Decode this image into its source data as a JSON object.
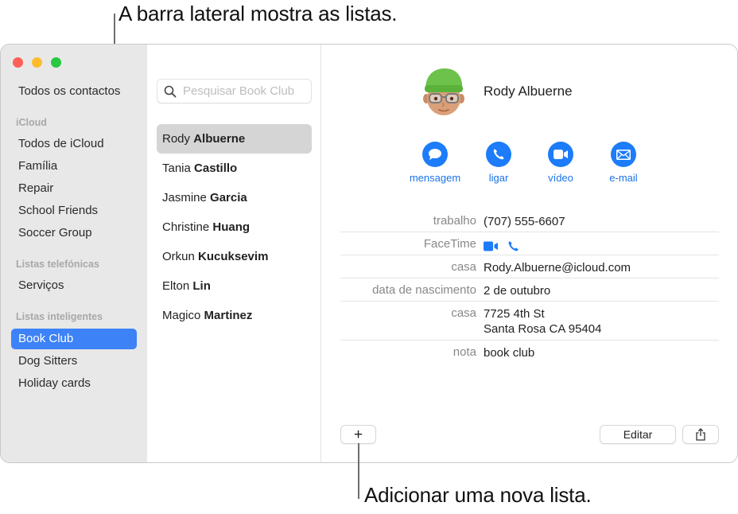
{
  "callouts": {
    "sidebar": "A barra lateral mostra as listas.",
    "add_list": "Adicionar uma nova lista."
  },
  "window": {
    "traffic_lights": [
      "close",
      "minimize",
      "zoom"
    ]
  },
  "sidebar": {
    "all_contacts": "Todos os contactos",
    "sections": [
      {
        "title": "iCloud",
        "items": [
          "Todos de iCloud",
          "Família",
          "Repair",
          "School Friends",
          "Soccer Group"
        ]
      },
      {
        "title": "Listas telefónicas",
        "items": [
          "Serviços"
        ]
      },
      {
        "title": "Listas inteligentes",
        "items": [
          "Book Club",
          "Dog Sitters",
          "Holiday cards"
        ]
      }
    ],
    "selected": "Book Club",
    "accent_color": "#3d82f7"
  },
  "list": {
    "search_placeholder": "Pesquisar Book Club",
    "search_value": "",
    "contacts": [
      {
        "first": "Rody",
        "last": "Albuerne",
        "selected": true
      },
      {
        "first": "Tania",
        "last": "Castillo"
      },
      {
        "first": "Jasmine",
        "last": "Garcia"
      },
      {
        "first": "Christine",
        "last": "Huang"
      },
      {
        "first": "Orkun",
        "last": "Kucuksevim"
      },
      {
        "first": "Elton",
        "last": "Lin"
      },
      {
        "first": "Magico",
        "last": "Martinez"
      }
    ]
  },
  "detail": {
    "name": "Rody Albuerne",
    "avatar": "memoji-green-beanie",
    "actions": [
      {
        "label": "mensagem",
        "icon": "message-bubble-icon"
      },
      {
        "label": "ligar",
        "icon": "phone-icon"
      },
      {
        "label": "vídeo",
        "icon": "video-camera-icon"
      },
      {
        "label": "e-mail",
        "icon": "envelope-icon"
      }
    ],
    "fields": [
      {
        "label": "trabalho",
        "value": "(707) 555-6607"
      },
      {
        "label": "FaceTime",
        "value": "",
        "icons": [
          "video-camera-icon",
          "phone-icon"
        ]
      },
      {
        "label": "casa",
        "value": "Rody.Albuerne@icloud.com"
      },
      {
        "label": "data de nascimento",
        "value": "2 de outubro"
      },
      {
        "label": "casa",
        "value_lines": [
          "7725 4th St",
          "Santa Rosa CA 95404"
        ]
      },
      {
        "label": "nota",
        "value": "book club"
      }
    ],
    "action_color": "#1c7cf9"
  },
  "footer": {
    "add_label": "+",
    "edit_label": "Editar",
    "share_icon": "share-icon"
  }
}
